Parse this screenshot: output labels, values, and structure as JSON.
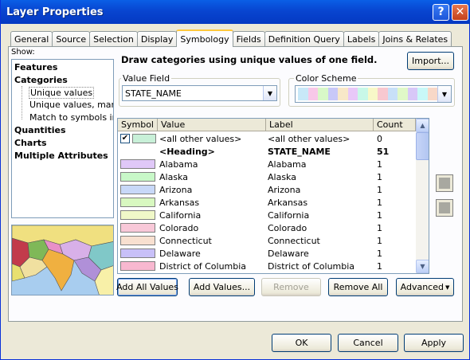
{
  "window": {
    "title": "Layer Properties"
  },
  "tabs": [
    "General",
    "Source",
    "Selection",
    "Display",
    "Symbology",
    "Fields",
    "Definition Query",
    "Labels",
    "Joins & Relates"
  ],
  "active_tab": "Symbology",
  "show": {
    "label": "Show:",
    "items": [
      "Features",
      "Categories",
      "Unique values",
      "Unique values, many f",
      "Match to symbols in a",
      "Quantities",
      "Charts",
      "Multiple Attributes"
    ]
  },
  "description": "Draw categories using unique values of one field.",
  "import_label": "Import...",
  "value_field": {
    "label": "Value Field",
    "value": "STATE_NAME"
  },
  "color_scheme": {
    "label": "Color Scheme",
    "colors": [
      "#c8e8f8",
      "#f8c8e8",
      "#d8f8c8",
      "#c8c8f8",
      "#f8e8c8",
      "#e8c8f8",
      "#c8f8e8",
      "#f8f8c8",
      "#f8c8d0",
      "#c8e0f8",
      "#e0f8c8",
      "#d8c8f8",
      "#c8f8f8",
      "#f8d8c8"
    ]
  },
  "grid": {
    "headers": [
      "Symbol",
      "Value",
      "Label",
      "Count"
    ],
    "rows": [
      {
        "value": "<all other values>",
        "label": "<all other values>",
        "count": "0",
        "color": "#c8f0d8",
        "checked": true
      },
      {
        "value": "<Heading>",
        "label": "STATE_NAME",
        "count": "51",
        "bold": true
      },
      {
        "value": "Alabama",
        "label": "Alabama",
        "count": "1",
        "color": "#e0c8f8"
      },
      {
        "value": "Alaska",
        "label": "Alaska",
        "count": "1",
        "color": "#c8f8c8"
      },
      {
        "value": "Arizona",
        "label": "Arizona",
        "count": "1",
        "color": "#c8d8f8"
      },
      {
        "value": "Arkansas",
        "label": "Arkansas",
        "count": "1",
        "color": "#d8f8c0"
      },
      {
        "value": "California",
        "label": "California",
        "count": "1",
        "color": "#f0f8c8"
      },
      {
        "value": "Colorado",
        "label": "Colorado",
        "count": "1",
        "color": "#f8c8d8"
      },
      {
        "value": "Connecticut",
        "label": "Connecticut",
        "count": "1",
        "color": "#f8e0d0"
      },
      {
        "value": "Delaware",
        "label": "Delaware",
        "count": "1",
        "color": "#c8c0f8"
      },
      {
        "value": "District of Columbia",
        "label": "District of Columbia",
        "count": "1",
        "color": "#f8b8d0"
      }
    ]
  },
  "buttons": {
    "add_all": "Add All Values",
    "add_values": "Add Values...",
    "remove": "Remove",
    "remove_all": "Remove All",
    "advanced": "Advanced"
  },
  "footer": {
    "ok": "OK",
    "cancel": "Cancel",
    "apply": "Apply"
  }
}
